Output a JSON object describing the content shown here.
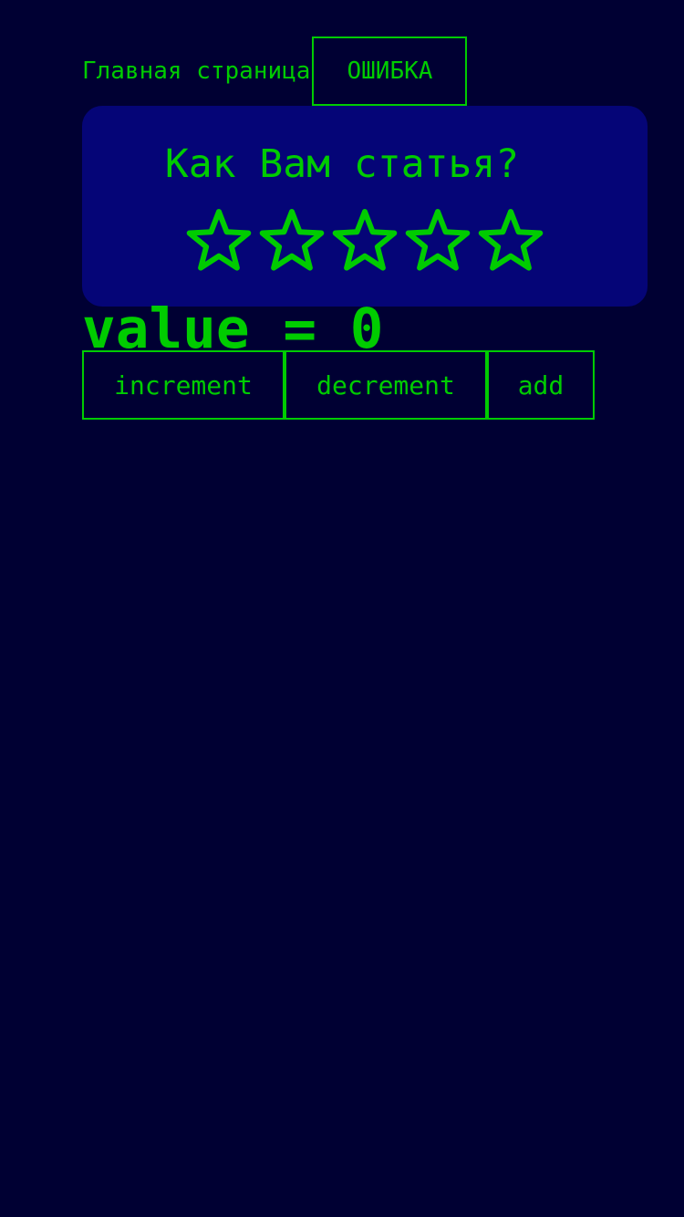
{
  "nav": {
    "home_label": "Главная страница",
    "error_label": "ОШИБКА"
  },
  "rating": {
    "question": "Как Вам статья?",
    "max_stars": 5,
    "selected_stars": 0,
    "star_icon": "star-outline-icon",
    "accent_color": "#00cc00"
  },
  "counter": {
    "value_text": "value = 0",
    "buttons": {
      "increment": "increment",
      "decrement": "decrement",
      "add": "add"
    }
  },
  "colors": {
    "background": "#000033",
    "card": "#050577",
    "accent": "#00cc00"
  }
}
